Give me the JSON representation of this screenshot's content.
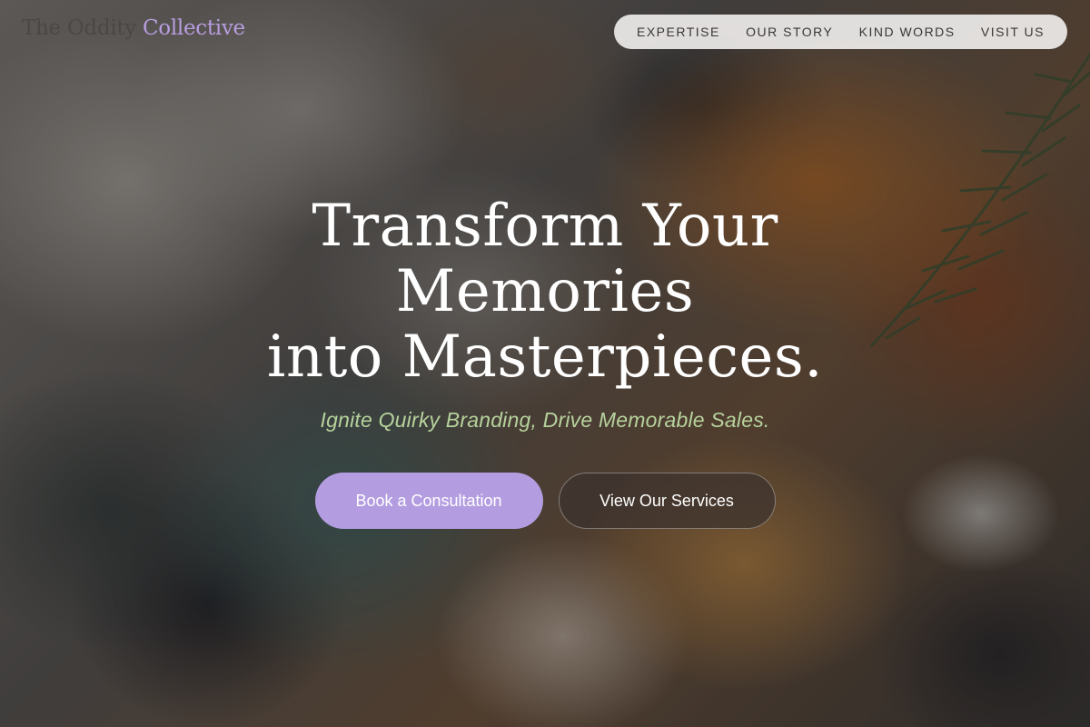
{
  "brand": {
    "name_part_1": "The Oddity",
    "name_part_2": "Collective"
  },
  "nav": {
    "items": [
      {
        "label": "EXPERTISE"
      },
      {
        "label": "OUR STORY"
      },
      {
        "label": "KIND WORDS"
      },
      {
        "label": "VISIT US"
      }
    ]
  },
  "hero": {
    "title_line_1": "Transform Your",
    "title_line_2": "Memories",
    "title_line_3": "into Masterpieces.",
    "subtitle": "Ignite Quirky Branding, Drive Memorable Sales.",
    "primary_cta": "Book a Consultation",
    "secondary_cta": "View Our Services"
  },
  "colors": {
    "accent_lavender": "#b39de0",
    "subtitle_green": "#b6d29c",
    "nav_background": "#eeecea"
  }
}
